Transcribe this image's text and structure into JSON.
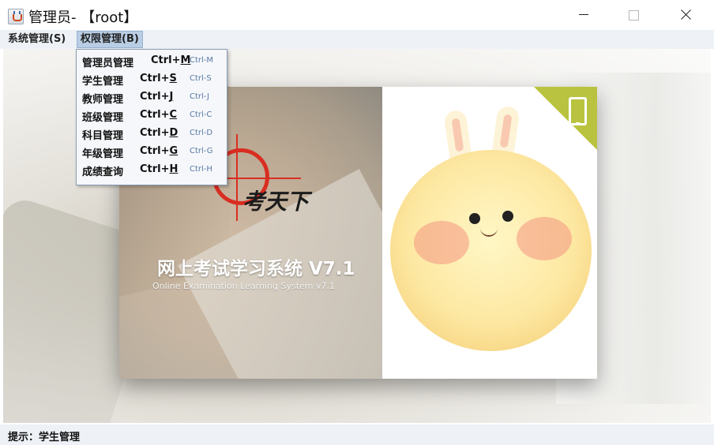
{
  "window": {
    "title": "管理员- 【root】",
    "controls": {
      "minimize": "minimize-icon",
      "maximize": "maximize-icon",
      "close": "close-icon"
    }
  },
  "menubar": {
    "items": [
      {
        "label": "系统管理(S)",
        "mnemonic": "S"
      },
      {
        "label": "权限管理(B)",
        "mnemonic": "B",
        "active": true
      }
    ]
  },
  "permission_menu": {
    "items": [
      {
        "label": "管理员管理",
        "accel_prefix": "Ctrl+",
        "accel_key": "M",
        "hint": "Ctrl-M"
      },
      {
        "label": "学生管理",
        "accel_prefix": "Ctrl+",
        "accel_key": "S",
        "hint": "Ctrl-S"
      },
      {
        "label": "教师管理",
        "accel_prefix": "Ctrl+",
        "accel_key": "J",
        "hint": "Ctrl-J"
      },
      {
        "label": "班级管理",
        "accel_prefix": "Ctrl+",
        "accel_key": "C",
        "hint": "Ctrl-C"
      },
      {
        "label": "科目管理",
        "accel_prefix": "Ctrl+",
        "accel_key": "D",
        "hint": "Ctrl-D"
      },
      {
        "label": "年级管理",
        "accel_prefix": "Ctrl+",
        "accel_key": "G",
        "hint": "Ctrl-G"
      },
      {
        "label": "成绩查询",
        "accel_prefix": "Ctrl+",
        "accel_key": "H",
        "hint": "Ctrl-H"
      }
    ]
  },
  "splash": {
    "logo_text": "考天下",
    "title": "网上考试学习系统 V7.1",
    "subtitle": "Online Examination Learning System v7.1"
  },
  "status": {
    "text": "提示：学生管理"
  }
}
